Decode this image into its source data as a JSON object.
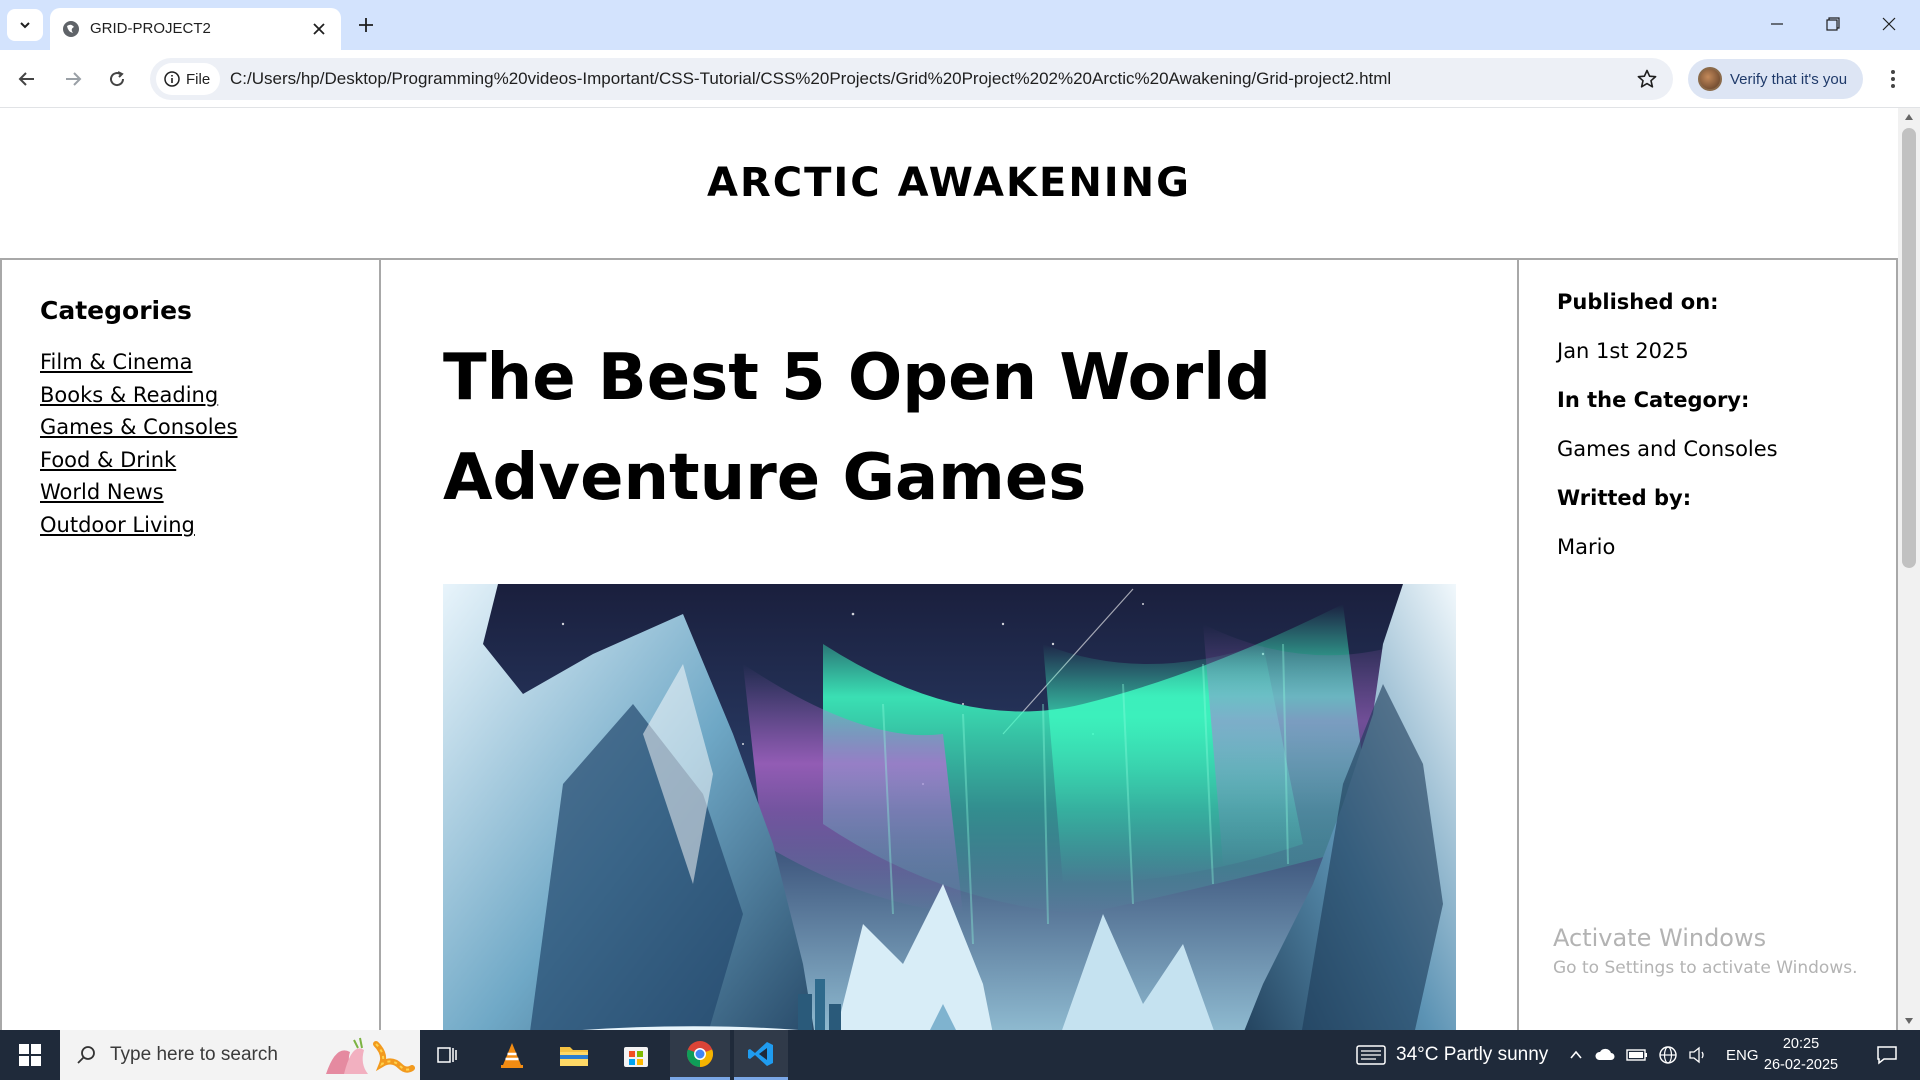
{
  "browser": {
    "tab_title": "GRID-PROJECT2",
    "file_chip": "File",
    "url": "C:/Users/hp/Desktop/Programming%20videos-Important/CSS-Tutorial/CSS%20Projects/Grid%20Project%202%20Arctic%20Awakening/Grid-project2.html",
    "profile_button": "Verify that it's you"
  },
  "page": {
    "site_title": "ARCTIC AWAKENING",
    "categories": {
      "heading": "Categories",
      "items": [
        {
          "label": "Film & Cinema"
        },
        {
          "label": "Books & Reading"
        },
        {
          "label": "Games & Consoles"
        },
        {
          "label": "Food & Drink"
        },
        {
          "label": "World News"
        },
        {
          "label": "Outdoor Living"
        }
      ]
    },
    "article": {
      "title": "The Best 5 Open World Adventure Games",
      "image_subject": "arctic-aurora-mountains"
    },
    "meta": {
      "published_label": "Published on:",
      "published_value": "Jan 1st 2025",
      "category_label": "In the Category:",
      "category_value": "Games and Consoles",
      "author_label": "Writted by:",
      "author_value": "Mario"
    }
  },
  "watermark": {
    "title": "Activate Windows",
    "subtitle": "Go to Settings to activate Windows."
  },
  "taskbar": {
    "search_placeholder": "Type here to search",
    "weather": "34°C  Partly sunny",
    "language": "ENG",
    "time": "20:25",
    "date": "26-02-2025"
  },
  "colors": {
    "chrome_tabbar": "#d3e3fd",
    "omnibox": "#edf0f6",
    "taskbar": "#1f2a3a",
    "border": "#a8a8a8"
  }
}
